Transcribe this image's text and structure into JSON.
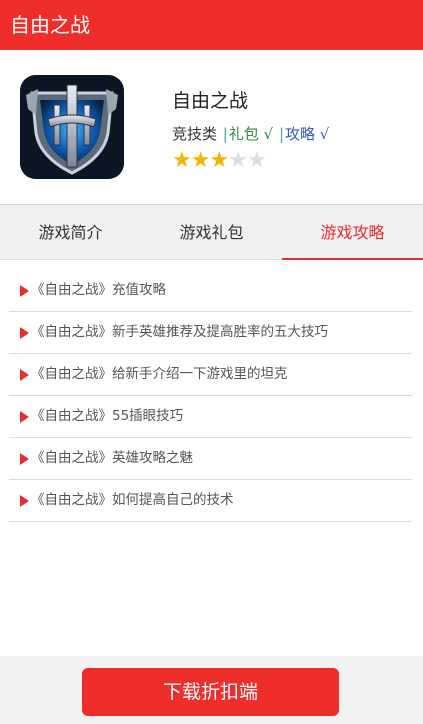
{
  "header": {
    "title": "自由之战"
  },
  "app": {
    "name": "自由之战",
    "category": "竞技类",
    "gift_label": "礼包 √",
    "guide_label": "攻略 √",
    "rating": 3,
    "rating_max": 5,
    "icon": "game-logo-icon"
  },
  "tabs": [
    {
      "label": "游戏简介",
      "active": false
    },
    {
      "label": "游戏礼包",
      "active": false
    },
    {
      "label": "游戏攻略",
      "active": true
    }
  ],
  "articles": [
    "《自由之战》充值攻略",
    "《自由之战》新手英雄推荐及提高胜率的五大技巧",
    "《自由之战》给新手介绍一下游戏里的坦克",
    "《自由之战》55插眼技巧",
    "《自由之战》英雄攻略之魅",
    "《自由之战》如何提高自己的技术"
  ],
  "footer": {
    "download_label": "下载折扣端"
  },
  "colors": {
    "accent": "#ef2d2a",
    "gift": "#2e8b3c",
    "guide": "#3558c8",
    "star": "#f4b400"
  }
}
